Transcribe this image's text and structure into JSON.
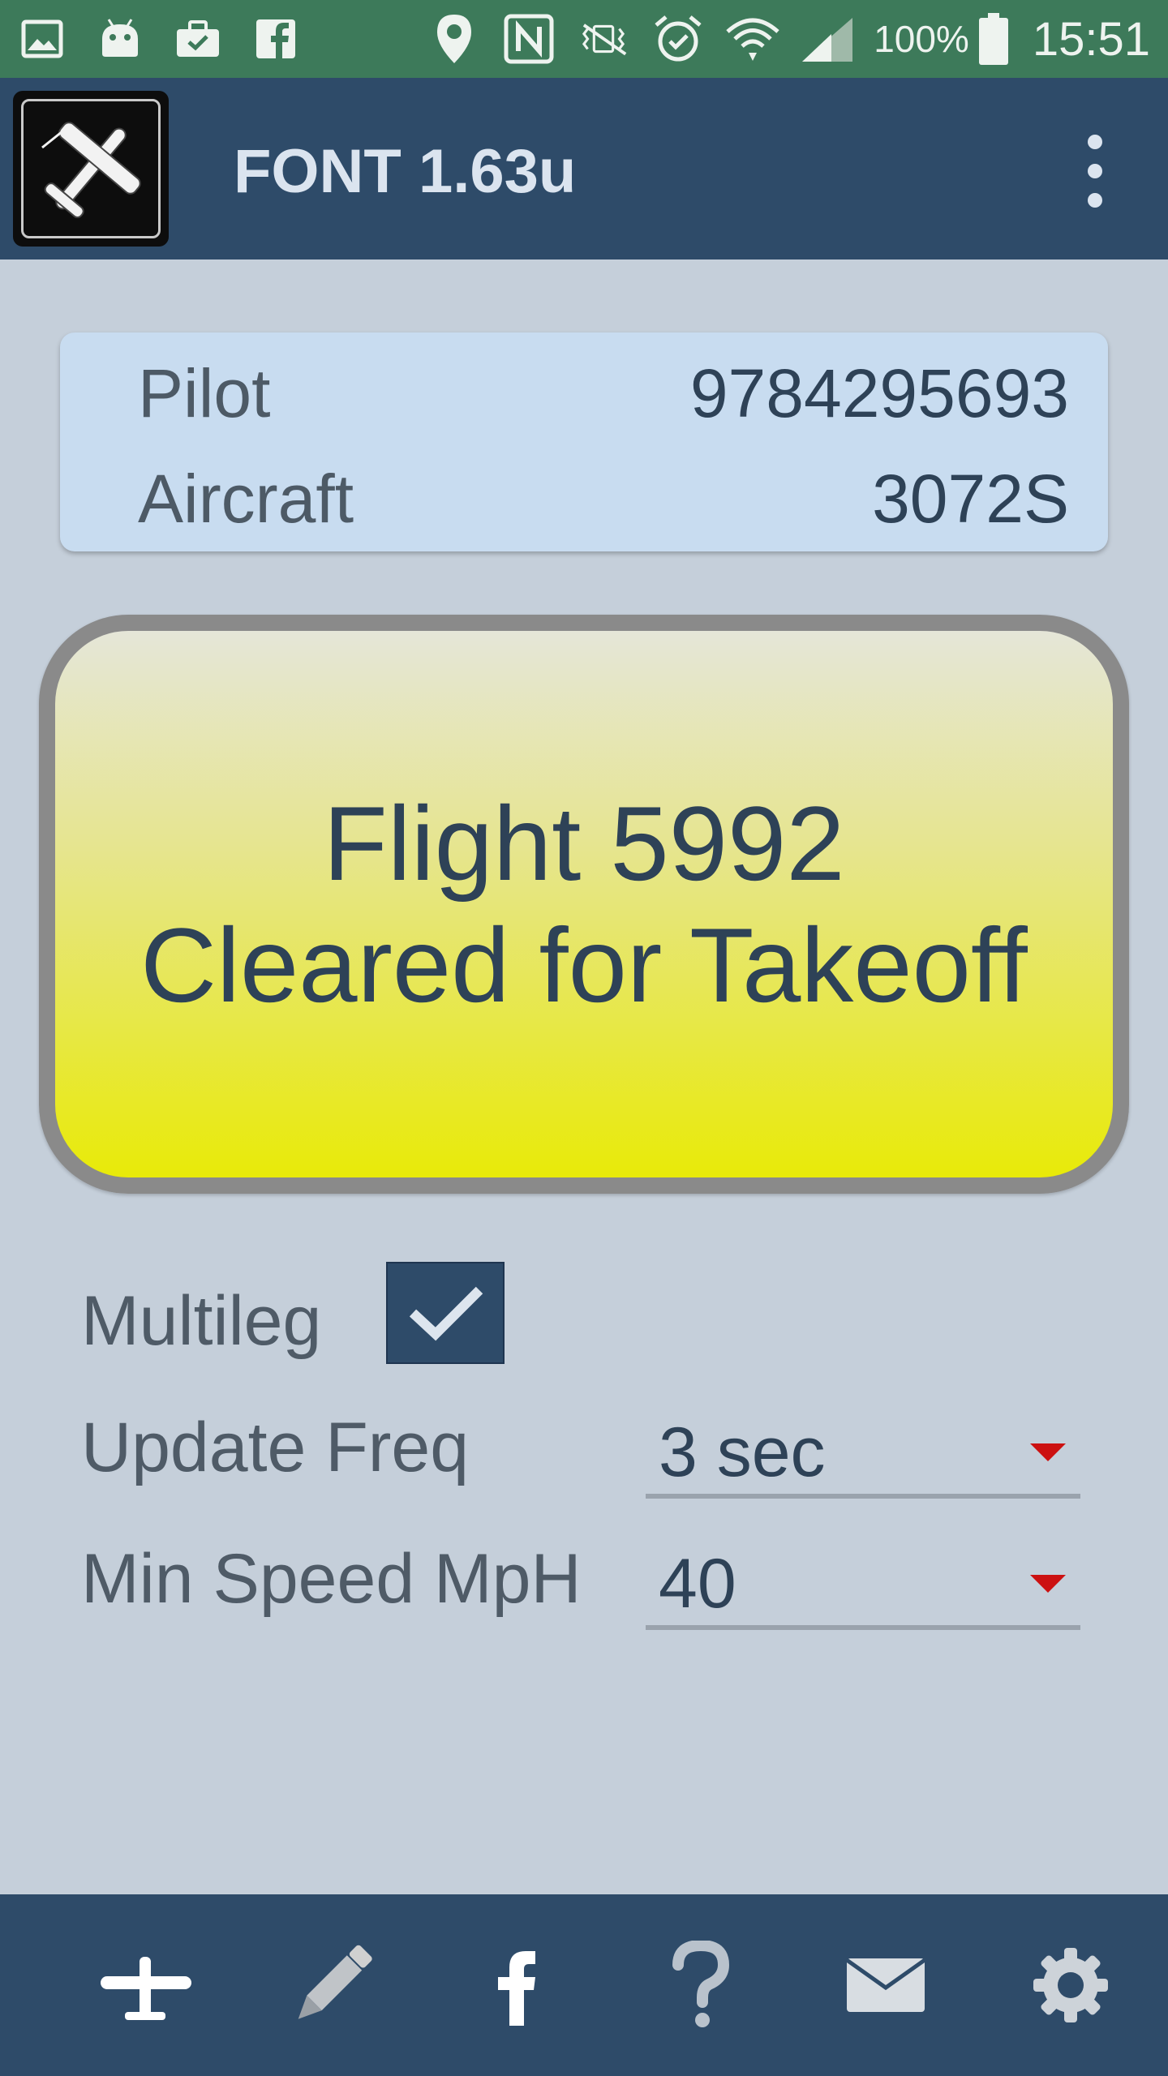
{
  "status_bar": {
    "battery_percent": "100%",
    "time": "15:51",
    "icons": [
      "gallery-icon",
      "android-icon",
      "briefcase-icon",
      "facebook-icon",
      "location-pin-icon",
      "nfc-icon",
      "vibrate-off-icon",
      "alarm-icon",
      "wifi-icon",
      "signal-icon",
      "battery-icon"
    ]
  },
  "app_bar": {
    "title": "FONT 1.63u",
    "logo_icon": "airplane-logo-icon",
    "menu_icon": "overflow-menu-icon"
  },
  "info_card": {
    "pilot_label": "Pilot",
    "pilot_value": "9784295693",
    "aircraft_label": "Aircraft",
    "aircraft_value": "3072S"
  },
  "status_button": {
    "line1": "Flight 5992",
    "line2": "Cleared for Takeoff"
  },
  "settings": {
    "multileg_label": "Multileg",
    "multileg_checked": true,
    "update_freq_label": "Update Freq",
    "update_freq_value": "3 sec",
    "min_speed_label": "Min Speed MpH",
    "min_speed_value": "40"
  },
  "bottom_nav": {
    "items": [
      "airplane-icon",
      "pencil-icon",
      "facebook-icon",
      "help-icon",
      "mail-icon",
      "settings-icon"
    ]
  },
  "colors": {
    "status_bar": "#3d7a5a",
    "app_bar": "#2e4b69",
    "background": "#c5cfda",
    "card": "#c8dcf0",
    "button_top": "#e5e6d8",
    "button_bottom": "#e8ea08",
    "spinner_arrow": "#cc1111"
  }
}
